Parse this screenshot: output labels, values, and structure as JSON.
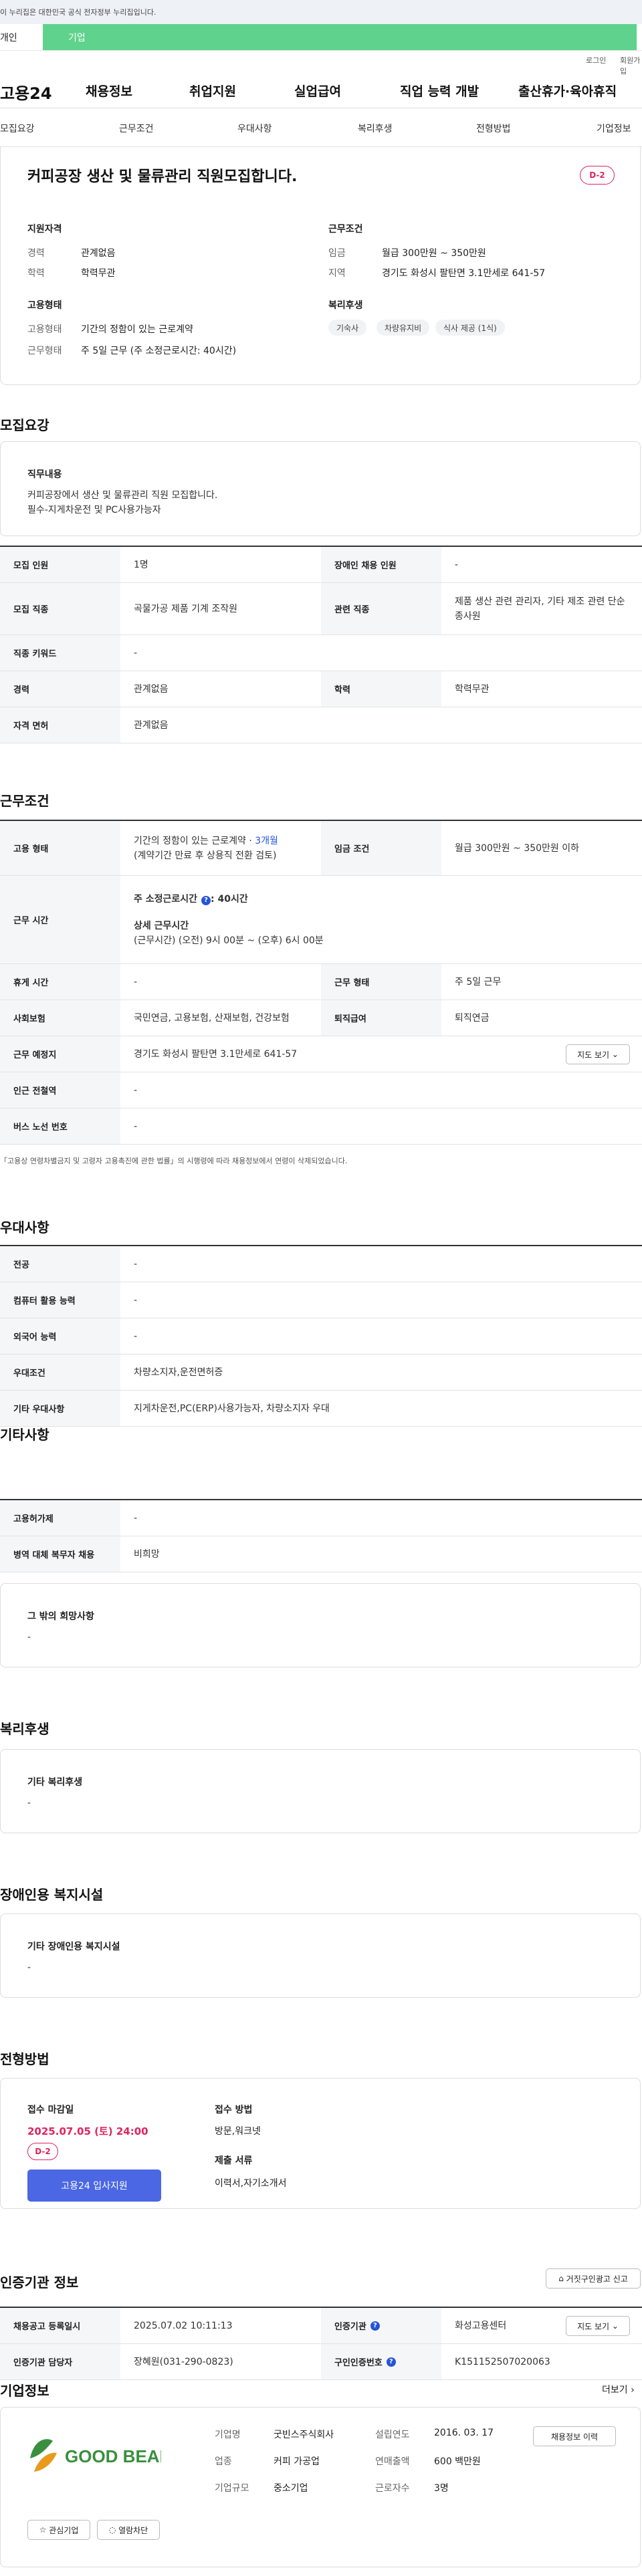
{
  "banner": {
    "text": "이 누리집은 대한민국 공식 전자정부 누리집입니다."
  },
  "user_tabs": {
    "personal": "개인",
    "company": "기업"
  },
  "util": {
    "login": "로그인",
    "join": "회원가입"
  },
  "gnb": {
    "logo": "고용24",
    "items": [
      "채용정보",
      "취업지원",
      "실업급여",
      "직업 능력 개발",
      "출산휴가·육아휴직"
    ]
  },
  "lnb": {
    "items": [
      "모집요강",
      "근무조건",
      "우대사항",
      "복리후생",
      "전형방법",
      "기업정보"
    ]
  },
  "summary": {
    "title": "커피공장 생산 및 물류관리 직원모집합니다.",
    "dday": "D-2",
    "qual": {
      "heading": "지원자격",
      "rows": [
        {
          "k": "경력",
          "v": "관계없음"
        },
        {
          "k": "학력",
          "v": "학력무관"
        }
      ]
    },
    "work": {
      "heading": "근무조건",
      "rows": [
        {
          "k": "임금",
          "v": "월급 300만원 ~ 350만원"
        },
        {
          "k": "지역",
          "v": "경기도 화성시 팔탄면 3.1만세로 641-57"
        }
      ]
    },
    "employ": {
      "heading": "고용형태",
      "rows": [
        {
          "k": "고용형태",
          "v": "기간의 정함이 있는 근로계약"
        },
        {
          "k": "근무형태",
          "v": "주 5일 근무 (주 소정근로시간: 40시간)"
        }
      ]
    },
    "welfare": {
      "heading": "복리후생",
      "chips": [
        "기숙사",
        "차량유지비",
        "식사 제공 (1식)"
      ]
    }
  },
  "recruit": {
    "title": "모집요강",
    "duty_heading": "직무내용",
    "duty_line1": "커피공장에서 생산 및 물류관리 직원 모집합니다.",
    "duty_line2": "필수-지게차운전 및 PC사용가능자",
    "rows": [
      {
        "k": "모집 인원",
        "v": "1명",
        "k2": "장애인 채용 인원",
        "v2": "-"
      },
      {
        "k": "모집 직종",
        "v": "곡물가공 제품 기계 조작원",
        "k2": "관련 직종",
        "v2": "제품 생산 관련 관리자, 기타 제조 관련 단순 종사원"
      },
      {
        "k": "직종 키워드",
        "v": "-"
      },
      {
        "k": "경력",
        "v": "관계없음",
        "k2": "학력",
        "v2": "학력무관"
      },
      {
        "k": "자격 면허",
        "v": "관계없음"
      }
    ]
  },
  "condition": {
    "title": "근무조건",
    "employ_k": "고용 형태",
    "employ_v1": "기간의 정함이 있는 근로계약 · ",
    "employ_v1b": "3개월",
    "employ_v2": "(계약기간 만료 후 상용직 전환 검토)",
    "wage_k": "임금 조건",
    "wage_v": "월급 300만원 ~ 350만원 이하",
    "hours_k": "근무 시간",
    "hours_l1a": "주 소정근로시간",
    "hours_l1b": "40시간",
    "hours_l2": "상세 근무시간",
    "hours_l3": "(근무시간) (오전) 9시 00분 ~ (오후) 6시 00분",
    "rest_k": "휴게 시간",
    "rest_v": "-",
    "form_k": "근무 형태",
    "form_v": "주 5일 근무",
    "ins_k": "사회보험",
    "ins_v": "국민연금, 고용보험, 산재보험, 건강보험",
    "ret_k": "퇴직급여",
    "ret_v": "퇴직연금",
    "place_k": "근무 예정지",
    "place_v": "경기도 화성시 팔탄면 3.1만세로 641-57",
    "map_btn": "지도 보기",
    "subway_k": "인근 전철역",
    "subway_v": "-",
    "bus_k": "버스 노선 번호",
    "bus_v": "-",
    "note": "「고용상 연령차별금지 및 고령자 고용촉진에 관한 법률」의 시행령에 따라 채용정보에서 연령이 삭제되었습니다."
  },
  "pref": {
    "title": "우대사항",
    "rows": [
      {
        "k": "전공",
        "v": "-"
      },
      {
        "k": "컴퓨터 활용 능력",
        "v": "-"
      },
      {
        "k": "외국어 능력",
        "v": "-"
      },
      {
        "k": "우대조건",
        "v": "차량소지자,운전면허증"
      },
      {
        "k": "기타 우대사항",
        "v": "지게차운전,PC(ERP)사용가능자, 차량소지자 우대"
      }
    ]
  },
  "etc": {
    "title": "기타사항",
    "rows": [
      {
        "k": "고용허가제",
        "v": "-"
      },
      {
        "k": "병역 대체 복무자 채용",
        "v": "비희망"
      }
    ],
    "hope_heading": "그 밖의 희망사항",
    "hope_value": "-"
  },
  "welfare": {
    "title": "복리후생",
    "heading": "기타 복리후생",
    "value": "-"
  },
  "disabled": {
    "title": "장애인용 복지시설",
    "heading": "기타 장애인용 복지시설",
    "value": "-"
  },
  "selection": {
    "title": "전형방법",
    "deadline_heading": "접수 마감일",
    "deadline": "2025.07.05 (토) 24:00",
    "dday": "D-2",
    "apply": "고용24 입사지원",
    "method_heading": "접수 방법",
    "method": "방문,워크넷",
    "docs_heading": "제출 서류",
    "docs": "이력서,자기소개서"
  },
  "agency": {
    "title": "인증기관 정보",
    "report_btn": "거짓구인광고 신고",
    "reg_k": "채용공고 등록일시",
    "reg_v": "2025.07.02 10:11:13",
    "org_k": "인증기관",
    "org_v": "화성고용센터",
    "map_btn": "지도 보기",
    "mgr_k": "인증기관 담당자",
    "mgr_v": "장혜원(031-290-0823)",
    "no_k": "구인인증번호",
    "no_v": "K151152507020063"
  },
  "company": {
    "title": "기업정보",
    "more": "더보기",
    "logo_text": "GOOD BEANS",
    "name_k": "기업명",
    "name_v": "굿빈스주식회사",
    "year_k": "설립연도",
    "year_v": "2016. 03. 17",
    "industry_k": "업종",
    "industry_v": "커피 가공업",
    "sales_k": "연매출액",
    "sales_v": "600 백만원",
    "size_k": "기업규모",
    "size_v": "중소기업",
    "emp_k": "근로자수",
    "emp_v": "3명",
    "interest_btn": "관심기업",
    "block_btn": "열람차단",
    "jobs_btn": "채용정보 이력",
    "brand_green": "#3a8f3e",
    "brand_orange": "#e89a1d"
  }
}
